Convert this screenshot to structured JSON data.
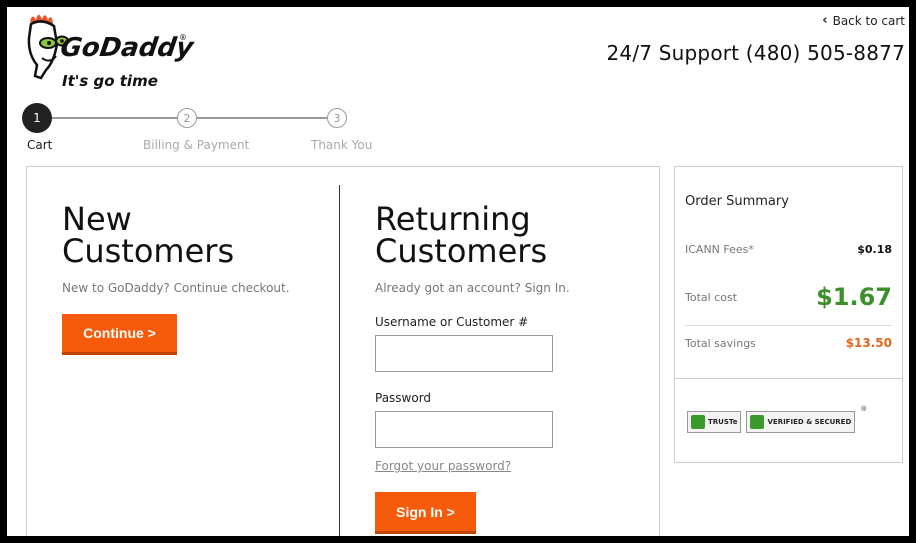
{
  "header": {
    "logo_name": "GoDaddy",
    "logo_tagline": "It's go time",
    "back_label": "Back to cart",
    "support_text": "24/7 Support (480) 505-8877"
  },
  "steps": [
    {
      "number": "1",
      "label": "Cart",
      "state": "active"
    },
    {
      "number": "2",
      "label": "Billing & Payment",
      "state": "inactive"
    },
    {
      "number": "3",
      "label": "Thank You",
      "state": "inactive"
    }
  ],
  "new_customers": {
    "title_line1": "New",
    "title_line2": "Customers",
    "subtitle": "New to GoDaddy? Continue checkout.",
    "button": "Continue >"
  },
  "returning_customers": {
    "title_line1": "Returning",
    "title_line2": "Customers",
    "subtitle": "Already got an account? Sign In.",
    "username_label": "Username or Customer #",
    "username_value": "",
    "password_label": "Password",
    "password_value": "",
    "forgot_link": "Forgot your password?",
    "button": "Sign In >"
  },
  "order_summary": {
    "title": "Order Summary",
    "icann_label": "ICANN Fees*",
    "icann_value": "$0.18",
    "total_label": "Total cost",
    "total_value": "$1.67",
    "savings_label": "Total savings",
    "savings_value": "$13.50",
    "badge_truste": "TRUSTe",
    "badge_verified": "VERIFIED & SECURED"
  },
  "colors": {
    "accent_orange": "#f55b0a",
    "total_green": "#3c8f2a",
    "savings_orange": "#e8631b"
  }
}
